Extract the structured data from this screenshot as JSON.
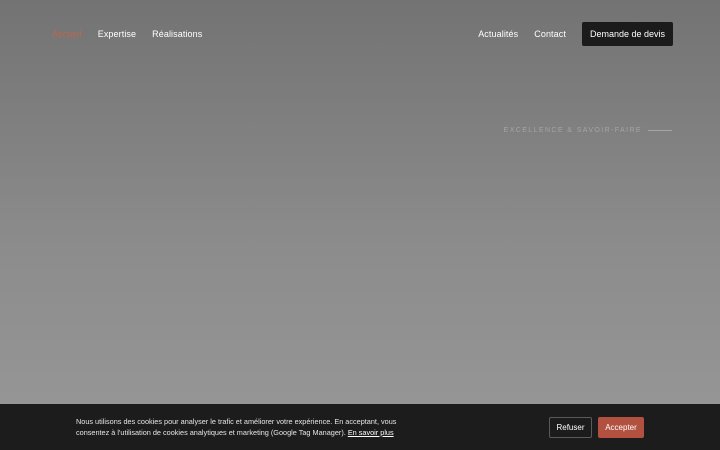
{
  "nav": {
    "left": [
      {
        "label": "Accueil",
        "active": true
      },
      {
        "label": "Expertise",
        "active": false
      },
      {
        "label": "Réalisations",
        "active": false
      }
    ],
    "right": [
      {
        "label": "Actualités"
      },
      {
        "label": "Contact"
      }
    ],
    "quote_button": "Demande de devis"
  },
  "hero": {
    "tagline": "Excellence & savoir-faire"
  },
  "cookie_banner": {
    "text": "Nous utilisons des cookies pour analyser le trafic et améliorer votre expérience. En acceptant, vous consentez à l'utilisation de cookies analytiques et marketing (Google Tag Manager).",
    "link": "En savoir plus",
    "refuse_label": "Refuser",
    "accept_label": "Accepter"
  },
  "colors": {
    "accent": "#c0654a",
    "accept": "#b35140",
    "banner": "#1c1c1c",
    "button_dark": "#1b1b1b"
  }
}
